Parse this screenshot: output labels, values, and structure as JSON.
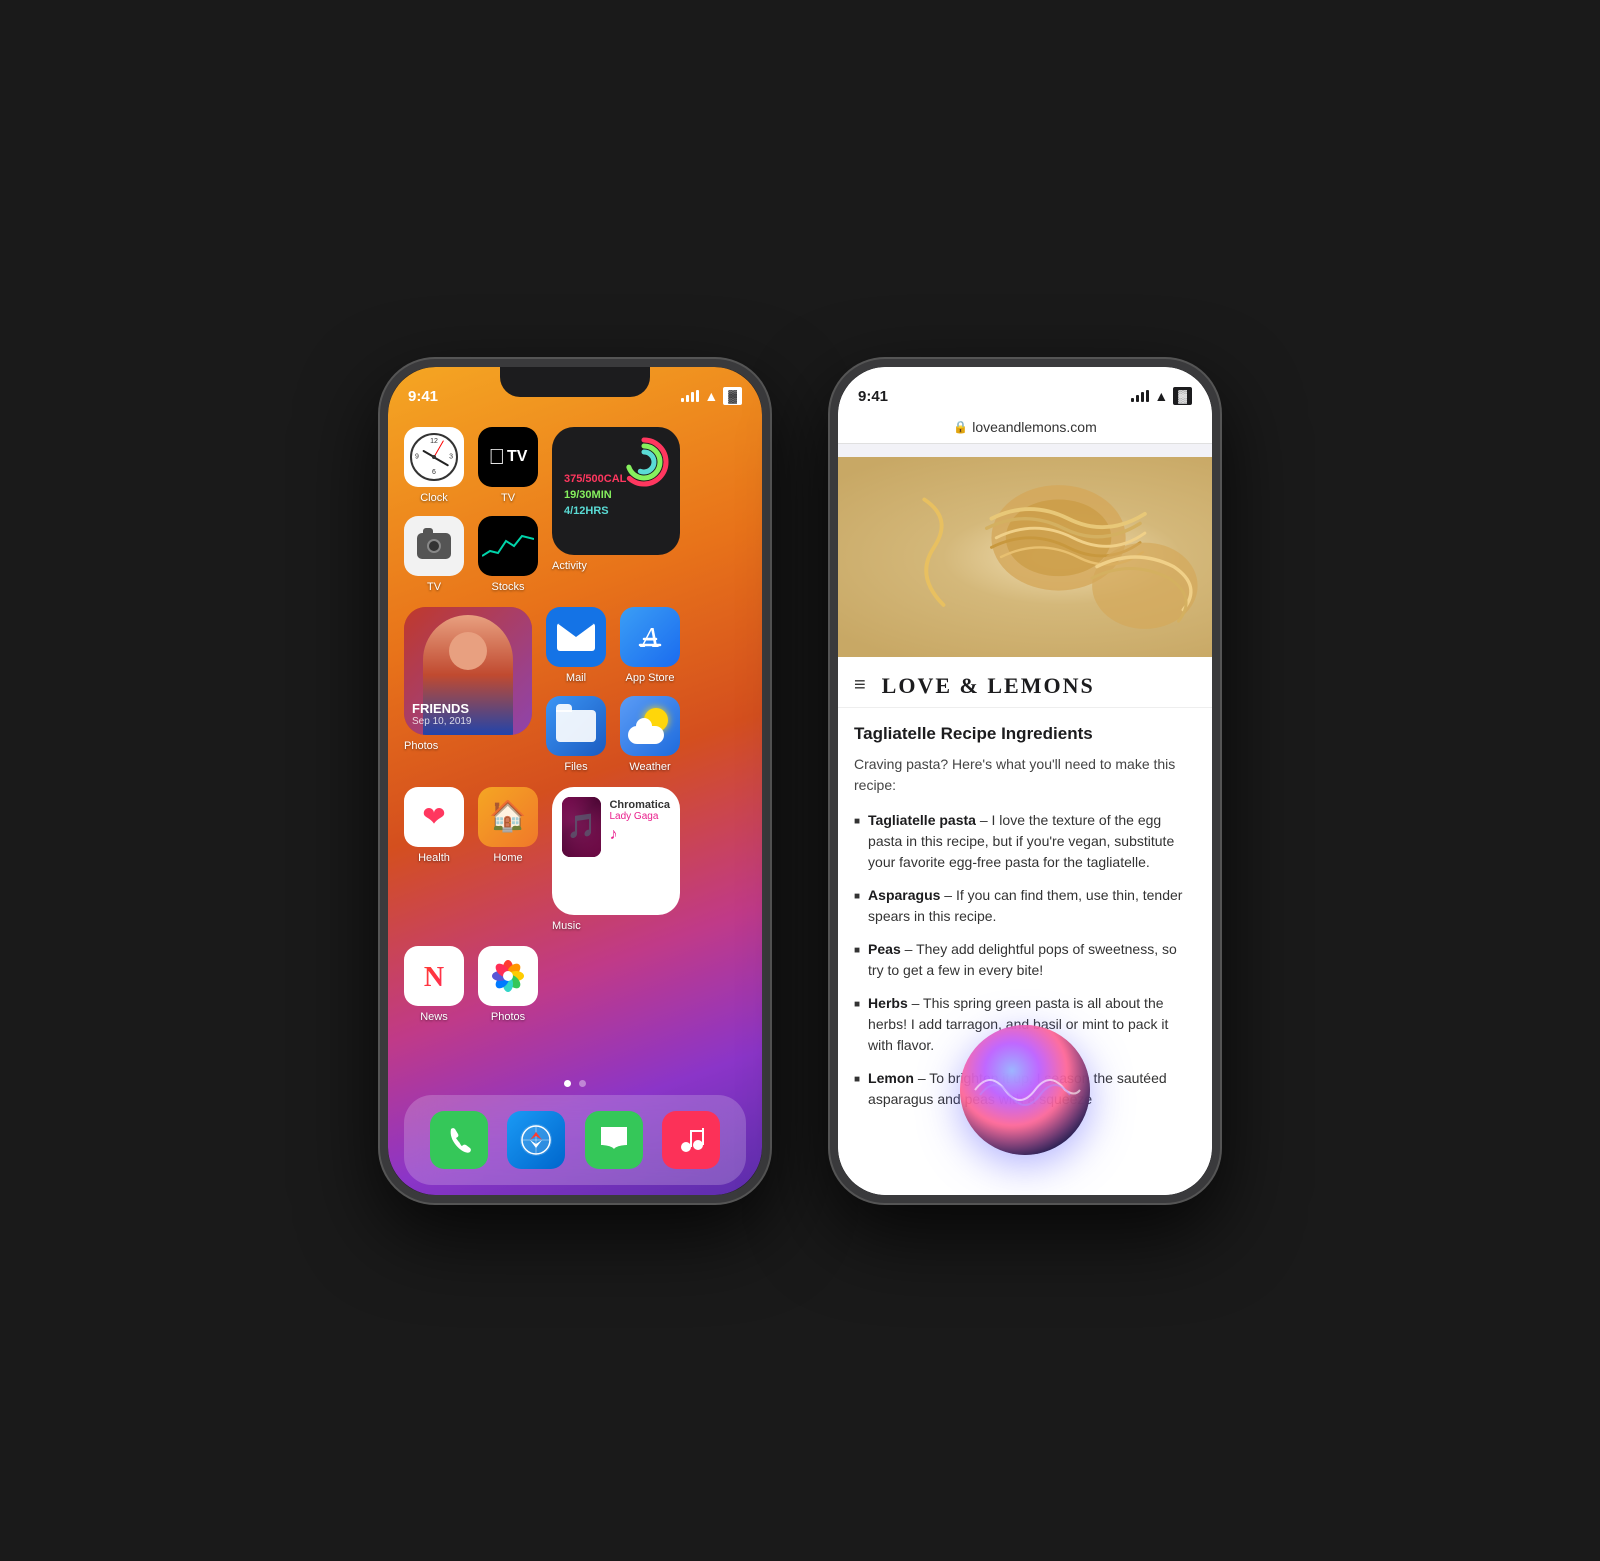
{
  "phone1": {
    "statusBar": {
      "time": "9:41",
      "signal": "●●●●",
      "wifi": "WiFi",
      "battery": "🔋"
    },
    "row1": {
      "clock": {
        "label": "Clock"
      },
      "camera": {
        "label": "Camera"
      },
      "activity": {
        "label": "Activity",
        "move": "375/500CAL",
        "exercise": "19/30MIN",
        "stand": "4/12HRS"
      }
    },
    "row2": {
      "tv": {
        "label": "TV"
      },
      "stocks": {
        "label": "Stocks"
      },
      "photos_widget": {
        "title": "FRIENDS",
        "date": "Sep 10, 2019",
        "label": "Photos"
      },
      "mail": {
        "label": "Mail"
      },
      "files": {
        "label": "Files"
      }
    },
    "row3": {
      "app_store": {
        "label": "App Store"
      },
      "weather": {
        "label": "Weather"
      },
      "health": {
        "label": "Health"
      },
      "home": {
        "label": "Home"
      },
      "music_widget": {
        "track": "Chromatica",
        "artist": "Lady Gaga",
        "label": "Music"
      }
    },
    "row4": {
      "news": {
        "label": "News"
      },
      "photos": {
        "label": "Photos"
      }
    },
    "dock": {
      "phone": "Phone",
      "safari": "Safari",
      "messages": "Messages",
      "music": "Music"
    }
  },
  "phone2": {
    "statusBar": {
      "time": "9:41"
    },
    "addressBar": {
      "lock": "🔒",
      "url": "loveandlemons.com"
    },
    "site": {
      "logo": "LOVE & LEMONS",
      "heroAlt": "Tagliatelle pasta noodles on marble surface"
    },
    "recipe": {
      "title": "Tagliatelle Recipe Ingredients",
      "intro": "Craving pasta? Here's what you'll need to make this recipe:",
      "ingredients": [
        {
          "name": "Tagliatelle pasta",
          "description": " – I love the texture of the egg pasta in this recipe, but if you're vegan, substitute your favorite egg-free pasta for the tagliatelle."
        },
        {
          "name": "Asparagus",
          "description": " – If you can find them, use thin, tender spears in this recipe."
        },
        {
          "name": "Peas",
          "description": " – They add delightful pops of sweetness, so try to get a few in every bite!"
        },
        {
          "name": "Herbs",
          "description": " – This spring green pasta is all about the herbs! I add tarragon, and basil or mint to pack it with flavor."
        },
        {
          "name": "Lemon",
          "description": " – To brighten it up, I season the sautéed asparagus and peas with a squeeze"
        }
      ]
    }
  }
}
